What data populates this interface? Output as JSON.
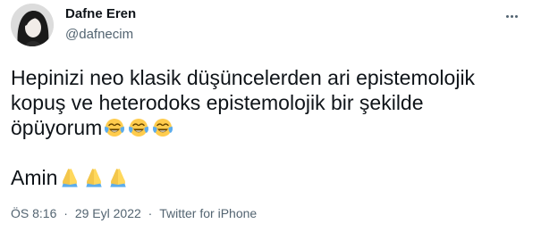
{
  "user": {
    "name": "Dafne Eren",
    "handle": "@dafnecim"
  },
  "tweet": {
    "lines": [
      "Hepinizi neo klasik düşüncelerden ari epistemolojik",
      "kopuş ve heterodoks epistemolojik bir şekilde",
      "öpüyorum",
      "Amin"
    ],
    "emoji_after_line_3": [
      "face-with-tears-of-joy",
      "face-with-tears-of-joy",
      "face-with-tears-of-joy"
    ],
    "emoji_after_line_4": [
      "folded-hands",
      "folded-hands",
      "folded-hands"
    ]
  },
  "meta": {
    "time": "ÖS 8:16",
    "date": "29 Eyl 2022",
    "separator": "·",
    "source": "Twitter for iPhone"
  },
  "colors": {
    "text": "#0f1419",
    "secondary": "#536471",
    "background": "#ffffff"
  }
}
